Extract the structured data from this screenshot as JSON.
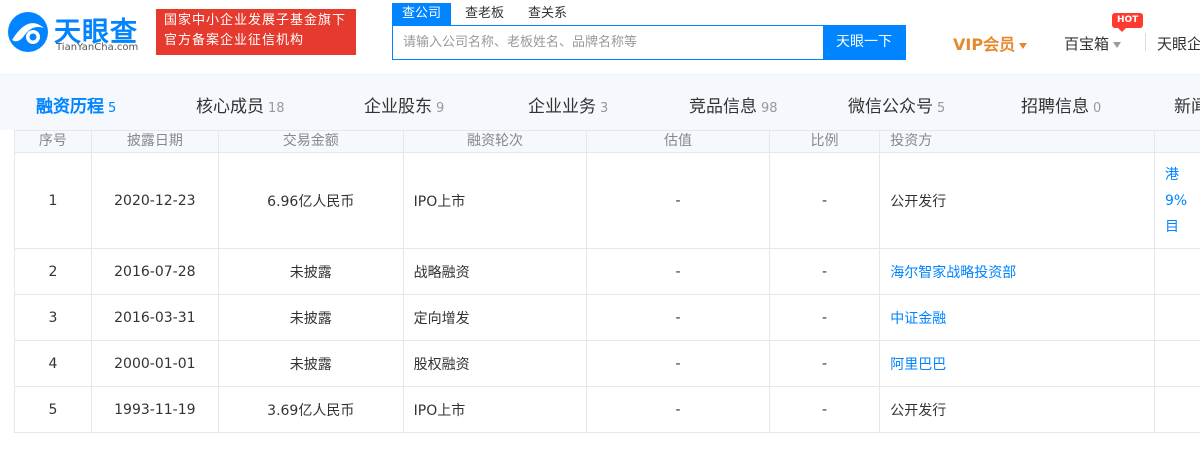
{
  "header": {
    "logo_cn": "天眼查",
    "logo_en": "TianYanCha.com",
    "slogan_line1": "国家中小企业发展子基金旗下",
    "slogan_line2": "官方备案企业征信机构",
    "search_tabs": [
      {
        "label": "查公司",
        "active": true
      },
      {
        "label": "查老板",
        "active": false
      },
      {
        "label": "查关系",
        "active": false
      }
    ],
    "search_placeholder": "请输入公司名称、老板姓名、品牌名称等",
    "search_button": "天眼一下",
    "vip_label": "VIP会员",
    "baobox_label": "百宝箱",
    "hot_badge": "HOT",
    "ent_label": "天眼企"
  },
  "nav": [
    {
      "label": "融资历程",
      "count": "5",
      "active": true
    },
    {
      "label": "核心成员",
      "count": "18",
      "active": false
    },
    {
      "label": "企业股东",
      "count": "9",
      "active": false
    },
    {
      "label": "企业业务",
      "count": "3",
      "active": false
    },
    {
      "label": "竞品信息",
      "count": "98",
      "active": false
    },
    {
      "label": "微信公众号",
      "count": "5",
      "active": false
    },
    {
      "label": "招聘信息",
      "count": "0",
      "active": false
    },
    {
      "label": "新闻",
      "count": "",
      "active": false
    }
  ],
  "table": {
    "headers": [
      "序号",
      "披露日期",
      "交易金额",
      "融资轮次",
      "估值",
      "比例",
      "投资方"
    ],
    "rows": [
      {
        "no": "1",
        "date": "2020-12-23",
        "amount": "6.96亿人民币",
        "round": "IPO上市",
        "valuation": "-",
        "ratio": "-",
        "investor": "公开发行",
        "investor_link": false
      },
      {
        "no": "2",
        "date": "2016-07-28",
        "amount": "未披露",
        "round": "战略融资",
        "valuation": "-",
        "ratio": "-",
        "investor": "海尔智家战略投资部",
        "investor_link": true
      },
      {
        "no": "3",
        "date": "2016-03-31",
        "amount": "未披露",
        "round": "定向增发",
        "valuation": "-",
        "ratio": "-",
        "investor": "中证金融",
        "investor_link": true
      },
      {
        "no": "4",
        "date": "2000-01-01",
        "amount": "未披露",
        "round": "股权融资",
        "valuation": "-",
        "ratio": "-",
        "investor": "阿里巴巴",
        "investor_link": true
      },
      {
        "no": "5",
        "date": "1993-11-19",
        "amount": "3.69亿人民币",
        "round": "IPO上市",
        "valuation": "-",
        "ratio": "-",
        "investor": "公开发行",
        "investor_link": false
      }
    ],
    "row1_extra": [
      "港",
      "9%",
      "目"
    ]
  },
  "colors": {
    "brand_blue": "#0084ff",
    "slogan_red": "#e63a2e",
    "vip_orange": "#e6892e"
  }
}
